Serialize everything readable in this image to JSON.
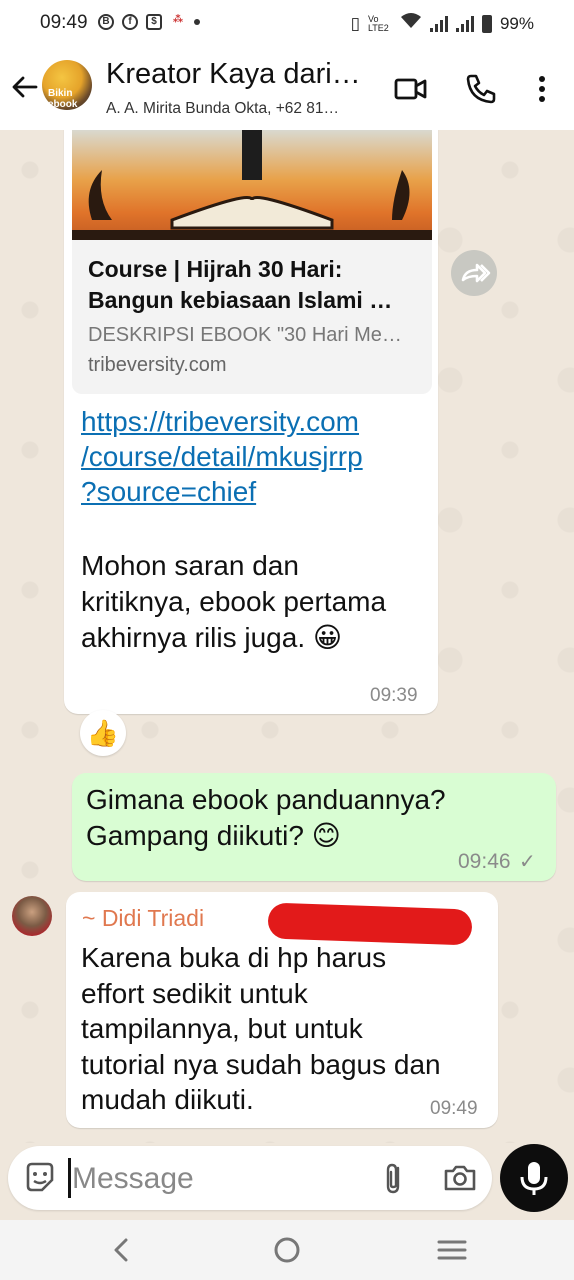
{
  "status_bar": {
    "time": "09:49",
    "network_label": "Vo LTE2",
    "battery_percent": "99%"
  },
  "header": {
    "title": "Kreator Kaya dari…",
    "subtitle": "A. A. Mirita Bunda Okta, +62 81…",
    "avatar_text": "Bikin ebook"
  },
  "messages": {
    "link_preview": {
      "title": "Course | Hijrah 30 Hari:\nBangun kebiasaan Islami …",
      "description": "DESKRIPSI EBOOK \"30 Hari Me…",
      "domain": "tribeversity.com"
    },
    "first": {
      "link_text": "https://tribeversity.com\n/course/detail/mkusjrrp\n?source=chief",
      "text": "Mohon saran dan\nkritiknya, ebook pertama\nakhirnya rilis juga. 😀",
      "time": "09:39",
      "reaction": "👍"
    },
    "outgoing": {
      "text": "Gimana ebook panduannya?\nGampang diikuti? 😊",
      "time": "09:46",
      "status": "✓"
    },
    "reply": {
      "sender": "~ Didi Triadi",
      "text": "Karena buka di hp harus\neffort sedikit untuk\ntampilannya, but untuk\ntutorial nya sudah bagus dan\nmudah diikuti.",
      "time": "09:49"
    }
  },
  "composer": {
    "placeholder": "Message"
  },
  "colors": {
    "outgoing_bubble": "#d9fdd3",
    "chat_background": "#efe7dc",
    "link": "#0b6fb3",
    "sender_name": "#e0784f"
  }
}
